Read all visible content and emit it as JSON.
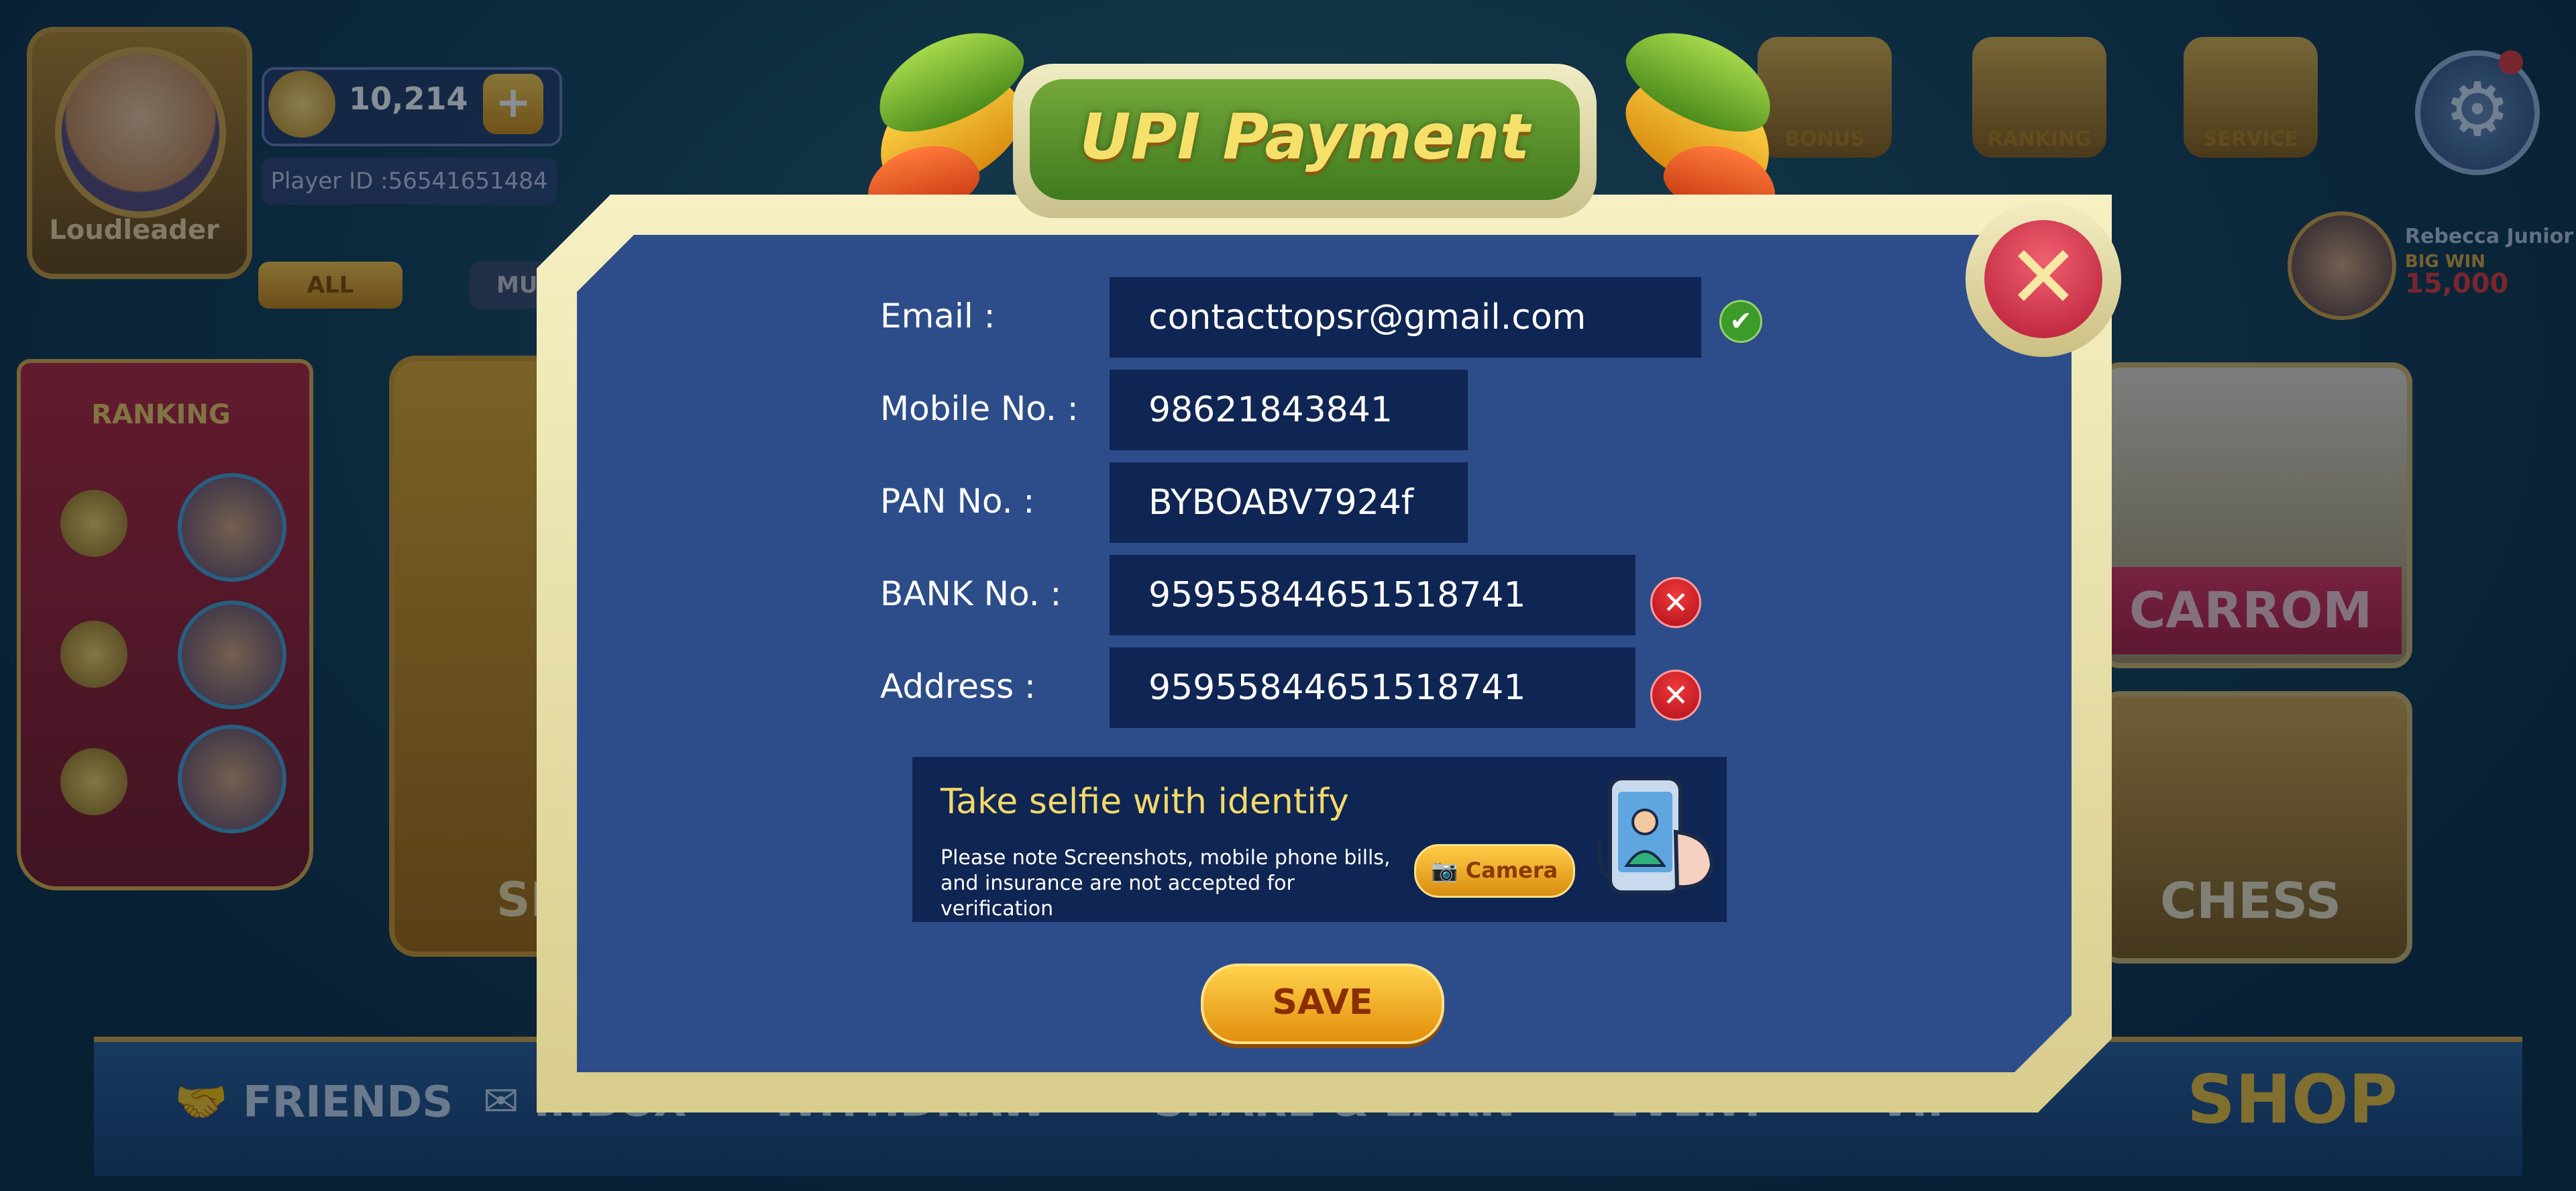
{
  "dialog": {
    "title": "UPI Payment",
    "close_icon": "close-x-icon",
    "fields": [
      {
        "label": "Email :",
        "value": "contacttopsr@gmail.com",
        "status": "valid"
      },
      {
        "label": "Mobile No. :",
        "value": "98621843841",
        "status": ""
      },
      {
        "label": "PAN No. :",
        "value": "BYBOABV7924f",
        "status": ""
      },
      {
        "label": "BANK No. :",
        "value": "95955844651518741",
        "status": "invalid"
      },
      {
        "label": "Address :",
        "value": "95955844651518741",
        "status": "invalid"
      }
    ],
    "selfie": {
      "title": "Take selfie with identify",
      "note": "Please note Screenshots, mobile phone bills, and insurance are not accepted for verification",
      "camera_label": "Camera",
      "illustration_icon": "hand-holding-phone-icon"
    },
    "save_label": "SAVE",
    "colors": {
      "panel": "#2c4d8a",
      "field": "#0f2553",
      "frame": "#f6f0c3",
      "title": "#f5e16a",
      "button": "#ffc43d"
    }
  },
  "background": {
    "player": {
      "name": "Loudleader",
      "coins": "10,214",
      "player_id": "Player ID :56541651484"
    },
    "filters": [
      "ALL",
      "MU"
    ],
    "ranking_title": "RANKING",
    "games": [
      "SLO",
      "CARROM",
      "CHESS"
    ],
    "top_buttons": [
      "BONUS",
      "RANKING",
      "SERVICE"
    ],
    "big_win": {
      "name": "Rebecca Junior",
      "label": "BIG WIN",
      "amount": "15,000"
    },
    "nav": [
      "FRIENDS",
      "INBOX",
      "WITHDRAW",
      "SHARE & EARN",
      "EVENT",
      "VIP"
    ],
    "shop": "SHOP"
  }
}
